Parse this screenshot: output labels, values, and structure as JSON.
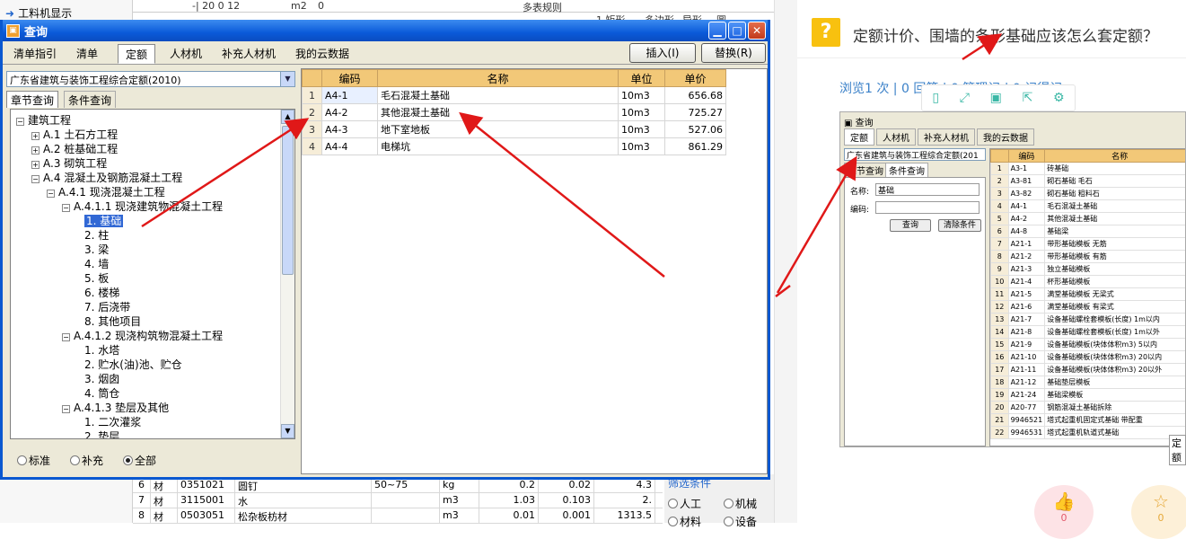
{
  "background": {
    "top_left_item": "工料机显示",
    "top_row": [
      "-| 20 0 12",
      "m2",
      "0",
      "",
      "多表规则"
    ],
    "top_row2": [
      "1 矩形",
      "多边形",
      "异形",
      "圆"
    ],
    "rows": [
      {
        "num": "6",
        "type": "材",
        "code": "0351021",
        "name": "圆钉",
        "spec": "50~75",
        "unit": "kg",
        "v1": "0.2",
        "v2": "0.02",
        "v3": "4.3"
      },
      {
        "num": "7",
        "type": "材",
        "code": "3115001",
        "name": "水",
        "spec": "",
        "unit": "m3",
        "v1": "1.03",
        "v2": "0.103",
        "v3": "2."
      },
      {
        "num": "8",
        "type": "材",
        "code": "0503051",
        "name": "松杂板枋材",
        "spec": "",
        "unit": "m3",
        "v1": "0.01",
        "v2": "0.001",
        "v3": "1313.5"
      }
    ],
    "filter": {
      "title": "筛选条件",
      "opt1": "人工",
      "opt2": "机械",
      "opt3": "材料",
      "opt4": "设备"
    }
  },
  "dialog": {
    "title": "查询",
    "tabs": [
      "清单指引",
      "清单",
      "定额",
      "人材机",
      "补充人材机",
      "我的云数据"
    ],
    "active_tab": "定额",
    "insert_button": "插入(I)",
    "replace_button": "替换(R)",
    "quota_library": "广东省建筑与装饰工程综合定额(2010)",
    "subtabs": [
      "章节查询",
      "条件查询"
    ],
    "tree": [
      {
        "label": "建筑工程",
        "level": 0,
        "exp": "−"
      },
      {
        "label": "A.1  土石方工程",
        "level": 1,
        "exp": "+"
      },
      {
        "label": "A.2  桩基础工程",
        "level": 1,
        "exp": "+"
      },
      {
        "label": "A.3  砌筑工程",
        "level": 1,
        "exp": "+"
      },
      {
        "label": "A.4  混凝土及钢筋混凝土工程",
        "level": 1,
        "exp": "−"
      },
      {
        "label": "A.4.1  现浇混凝土工程",
        "level": 2,
        "exp": "−"
      },
      {
        "label": "A.4.1.1  现浇建筑物混凝土工程",
        "level": 3,
        "exp": "−"
      },
      {
        "label": "1.  基础",
        "level": 4,
        "exp": "",
        "selected": true
      },
      {
        "label": "2.  柱",
        "level": 4,
        "exp": ""
      },
      {
        "label": "3.  梁",
        "level": 4,
        "exp": ""
      },
      {
        "label": "4.  墙",
        "level": 4,
        "exp": ""
      },
      {
        "label": "5.  板",
        "level": 4,
        "exp": ""
      },
      {
        "label": "6.  楼梯",
        "level": 4,
        "exp": ""
      },
      {
        "label": "7.  后浇带",
        "level": 4,
        "exp": ""
      },
      {
        "label": "8.  其他项目",
        "level": 4,
        "exp": ""
      },
      {
        "label": "A.4.1.2  现浇构筑物混凝土工程",
        "level": 3,
        "exp": "−"
      },
      {
        "label": "1.  水塔",
        "level": 4,
        "exp": ""
      },
      {
        "label": "2.  贮水(油)池、贮仓",
        "level": 4,
        "exp": ""
      },
      {
        "label": "3.  烟囱",
        "level": 4,
        "exp": ""
      },
      {
        "label": "4.  筒仓",
        "level": 4,
        "exp": ""
      },
      {
        "label": "A.4.1.3  垫层及其他",
        "level": 3,
        "exp": "−"
      },
      {
        "label": "1.  二次灌浆",
        "level": 4,
        "exp": ""
      },
      {
        "label": "2.  垫层",
        "level": 4,
        "exp": ""
      }
    ],
    "radio_options": [
      "标准",
      "补充",
      "全部"
    ],
    "radio_selected": "全部",
    "grid_headers": [
      "编码",
      "名称",
      "单位",
      "单价"
    ],
    "grid_rows": [
      {
        "n": "1",
        "code": "A4-1",
        "name": "毛石混凝土基础",
        "unit": "10m3",
        "price": "656.68"
      },
      {
        "n": "2",
        "code": "A4-2",
        "name": "其他混凝土基础",
        "unit": "10m3",
        "price": "725.27"
      },
      {
        "n": "3",
        "code": "A4-3",
        "name": "地下室地板",
        "unit": "10m3",
        "price": "527.06"
      },
      {
        "n": "4",
        "code": "A4-4",
        "name": "电梯坑",
        "unit": "10m3",
        "price": "861.29"
      }
    ]
  },
  "question": {
    "title": "定额计价、围墙的条形基础应该怎么套定额？",
    "meta": "浏览1 次 | 0 回答 | 0 管理记 | 0 记得记",
    "toolbar_icons": [
      "phone-icon",
      "expand-icon",
      "save-icon",
      "share-icon",
      "settings-icon"
    ],
    "shot": {
      "title": "查询",
      "tabs": [
        "定额",
        "人材机",
        "补充人材机",
        "我的云数据"
      ],
      "library": "广东省建筑与装饰工程综合定额(201",
      "subtabs": [
        "章节查询",
        "条件查询"
      ],
      "name_label": "名称:",
      "name_value": "基础",
      "code_label": "编码:",
      "search_button": "查询",
      "clear_button": "清除条件",
      "headers": [
        "编码",
        "名称"
      ],
      "rows": [
        [
          "1",
          "A3-1",
          "砖基础"
        ],
        [
          "2",
          "A3-81",
          "砌石基础 毛石"
        ],
        [
          "3",
          "A3-82",
          "砌石基础 粗料石"
        ],
        [
          "4",
          "A4-1",
          "毛石混凝土基础"
        ],
        [
          "5",
          "A4-2",
          "其他混凝土基础"
        ],
        [
          "6",
          "A4-8",
          "基础梁"
        ],
        [
          "7",
          "A21-1",
          "带形基础模板 无筋"
        ],
        [
          "8",
          "A21-2",
          "带形基础模板 有筋"
        ],
        [
          "9",
          "A21-3",
          "独立基础模板"
        ],
        [
          "10",
          "A21-4",
          "杯形基础模板"
        ],
        [
          "11",
          "A21-5",
          "满堂基础模板 无梁式"
        ],
        [
          "12",
          "A21-6",
          "满堂基础模板 有梁式"
        ],
        [
          "13",
          "A21-7",
          "设备基础螺栓套模板(长度) 1m以内"
        ],
        [
          "14",
          "A21-8",
          "设备基础螺栓套模板(长度) 1m以外"
        ],
        [
          "15",
          "A21-9",
          "设备基础模板(块体体积m3) 5以内"
        ],
        [
          "16",
          "A21-10",
          "设备基础模板(块体体积m3) 20以内"
        ],
        [
          "17",
          "A21-11",
          "设备基础模板(块体体积m3) 20以外"
        ],
        [
          "18",
          "A21-12",
          "基础垫层模板"
        ],
        [
          "19",
          "A21-24",
          "基础梁模板"
        ],
        [
          "20",
          "A20-77",
          "钢筋混凝土基础拆除"
        ],
        [
          "21",
          "9946521",
          "塔式起重机固定式基础 带配重"
        ],
        [
          "22",
          "9946531",
          "塔式起重机轨道式基础"
        ]
      ],
      "overflow_label": "定额"
    },
    "like_count": "0",
    "star_count": "0"
  }
}
